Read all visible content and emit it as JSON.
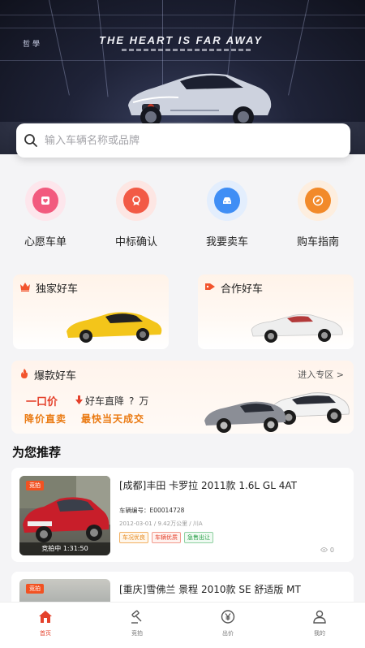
{
  "hero": {
    "brand": "哲學",
    "title": "THE HEART IS FAR AWAY"
  },
  "search": {
    "placeholder": "输入车辆名称或品牌",
    "icon": "search-icon"
  },
  "quick_actions": [
    {
      "label": "心愿车单",
      "icon": "wishlist-icon",
      "color": "#f25a7e",
      "halo": "#fde6ec"
    },
    {
      "label": "中标确认",
      "icon": "award-icon",
      "color": "#f25a45",
      "halo": "#fde6e3"
    },
    {
      "label": "我要卖车",
      "icon": "car-icon",
      "color": "#3f8ef5",
      "halo": "#e3eefd"
    },
    {
      "label": "购车指南",
      "icon": "compass-icon",
      "color": "#f28a2a",
      "halo": "#fdeedf"
    }
  ],
  "promos": {
    "exclusive": {
      "title": "独家好车",
      "icon": "crown-icon"
    },
    "partner": {
      "title": "合作好车",
      "icon": "tag-icon"
    },
    "hot": {
      "title": "爆款好车",
      "icon": "fire-icon",
      "enter": "进入专区 >",
      "price_label": "一口价",
      "drop_label": "好车直降",
      "drop_unit": "万",
      "slogan_1": "降价直卖",
      "slogan_2": "最快当天成交"
    }
  },
  "section_title": "为您推荐",
  "listings": [
    {
      "tag": "竞拍",
      "timer": "竞拍中 1:31:50",
      "title": "[成都]丰田 卡罗拉 2011款 1.6L GL 4AT",
      "car_id": "车辆编号：E00014728",
      "meta": "2012-03-01 / 9.42万公里 / 川A",
      "badges": [
        "车况优良",
        "车辆优质",
        "急售出让"
      ],
      "views": "0"
    },
    {
      "tag": "竞拍",
      "title": "[重庆]雪佛兰 景程 2010款 SE 舒适版 MT"
    }
  ],
  "tabs": [
    {
      "label": "首页",
      "icon": "home-icon",
      "active": true
    },
    {
      "label": "竞拍",
      "icon": "gavel-icon",
      "active": false
    },
    {
      "label": "出价",
      "icon": "yuan-icon",
      "active": false
    },
    {
      "label": "我的",
      "icon": "profile-icon",
      "active": false
    }
  ]
}
